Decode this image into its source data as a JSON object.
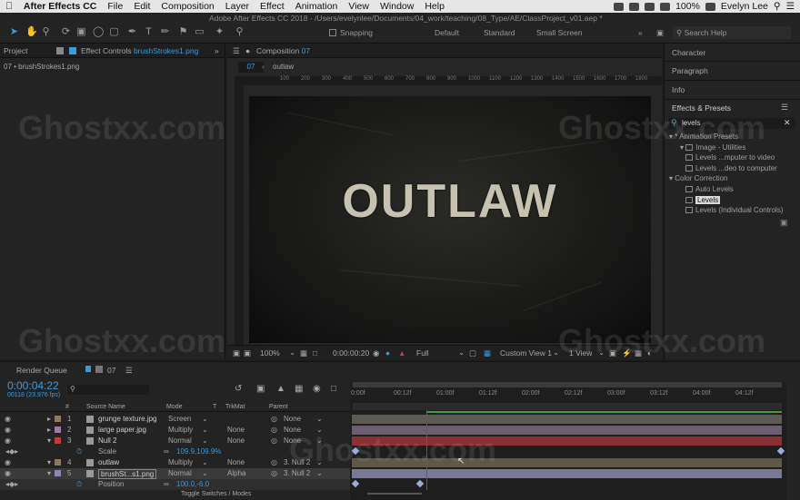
{
  "menubar": {
    "app": "After Effects CC",
    "items": [
      "File",
      "Edit",
      "Composition",
      "Layer",
      "Effect",
      "Animation",
      "View",
      "Window",
      "Help"
    ],
    "battery": "100%",
    "user": "Evelyn Lee"
  },
  "title": "Adobe After Effects CC 2018 - /Users/evelynlee/Documents/04_work/teaching/08_Type/AE/ClassProject_v01.aep *",
  "workspace": {
    "snapping": "Snapping",
    "items": [
      "Default",
      "Standard",
      "Small Screen"
    ],
    "search": "Search Help"
  },
  "left": {
    "tab1": "Project",
    "tab2_prefix": "Effect Controls ",
    "tab2_file": "brushStrokes1.png",
    "sub": "07 • brushStrokes1.png"
  },
  "comp": {
    "tab_prefix": "Composition ",
    "tab_num": "07",
    "crumb_num": "07",
    "crumb_name": "outlaw",
    "ruler": [
      "100",
      "200",
      "300",
      "400",
      "500",
      "600",
      "700",
      "800",
      "900",
      "1000",
      "1100",
      "1200",
      "1300",
      "1400",
      "1500",
      "1600",
      "1700",
      "1800"
    ],
    "text": "OUTLAW",
    "zoom": "100%",
    "time": "0:00:00:20",
    "quality": "Full",
    "view": "Custom View 1",
    "views": "1 View"
  },
  "right": {
    "character": "Character",
    "paragraph": "Paragraph",
    "info": "Info",
    "effects": "Effects & Presets",
    "search": "levels",
    "tree": [
      {
        "label": "* Animation Presets",
        "level": 0,
        "icon": false
      },
      {
        "label": "Image - Utilities",
        "level": 1,
        "icon": false
      },
      {
        "label": "Levels ...mputer to video",
        "level": 2,
        "icon": true
      },
      {
        "label": "Levels ...deo to computer",
        "level": 2,
        "icon": true
      },
      {
        "label": "Color Correction",
        "level": 0,
        "icon": false
      },
      {
        "label": "Auto Levels",
        "level": 2,
        "icon": true
      },
      {
        "label": "Levels",
        "level": 2,
        "icon": true,
        "selected": true
      },
      {
        "label": "Levels (Individual Controls)",
        "level": 2,
        "icon": true
      }
    ]
  },
  "timeline": {
    "tab_queue": "Render Queue",
    "tab_comp": "07",
    "timecode": "0:00:04:22",
    "frames": "00118 (23.976 fps)",
    "headers": {
      "num": "#",
      "source": "Source Name",
      "mode": "Mode",
      "t": "T",
      "trkmat": "TrkMat",
      "parent": "Parent"
    },
    "layers": [
      {
        "num": "1",
        "name": "grunge texture.jpg",
        "mode": "Screen",
        "trk": "",
        "parent": "None",
        "color": "#8d7d5c"
      },
      {
        "num": "2",
        "name": "large paper.jpg",
        "mode": "Multiply",
        "trk": "None",
        "parent": "None",
        "color": "#a27aa4"
      },
      {
        "num": "3",
        "name": "Null 2",
        "mode": "Normal",
        "trk": "None",
        "parent": "None",
        "color": "#c0393b"
      },
      {
        "num": "4",
        "name": "outlaw",
        "mode": "Multiply",
        "trk": "None",
        "parent": "3. Null 2",
        "color": "#8b7a5b"
      },
      {
        "num": "5",
        "name": "brushSt...s1.png",
        "mode": "Normal",
        "trk": "Alpha",
        "parent": "3. Null 2",
        "color": "#8b86b6"
      }
    ],
    "scale_label": "Scale",
    "scale_value": "109.9,109.9%",
    "position_label": "Position",
    "position_value": "100.0,-6.0",
    "ticks": [
      "0:00f",
      "00:12f",
      "01:00f",
      "01:12f",
      "02:00f",
      "02:12f",
      "03:00f",
      "03:12f",
      "04:00f",
      "04:12f"
    ],
    "toggle": "Toggle Switches / Modes"
  },
  "watermark": "Ghostxx.com"
}
